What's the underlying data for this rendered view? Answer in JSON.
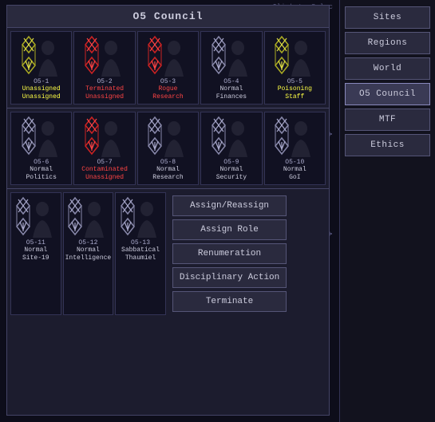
{
  "panel": {
    "title": "O5 Council"
  },
  "nav": {
    "buttons": [
      {
        "label": "Sites",
        "active": false
      },
      {
        "label": "Regions",
        "active": false
      },
      {
        "label": "World",
        "active": false
      },
      {
        "label": "O5 Council",
        "active": true
      },
      {
        "label": "MTF",
        "active": false
      },
      {
        "label": "Ethics",
        "active": false
      }
    ]
  },
  "agents": [
    {
      "id": "O5-1",
      "status_line1": "Unassigned",
      "status_line2": "Unassigned",
      "status_class": "status-unassigned",
      "flag": "unassigned"
    },
    {
      "id": "O5-2",
      "status_line1": "Terminated",
      "status_line2": "Unassigned",
      "status_class": "status-terminated",
      "flag": "terminated"
    },
    {
      "id": "O5-3",
      "status_line1": "Rogue",
      "status_line2": "Research",
      "status_class": "status-rogue",
      "flag": "rogue"
    },
    {
      "id": "O5-4",
      "status_line1": "Normal",
      "status_line2": "Finances",
      "status_class": "status-normal",
      "flag": "normal"
    },
    {
      "id": "O5-5",
      "status_line1": "Poisoning",
      "status_line2": "Staff",
      "status_class": "status-poisoning",
      "flag": "poisoning"
    },
    {
      "id": "O5-6",
      "status_line1": "Normal",
      "status_line2": "Politics",
      "status_class": "status-normal",
      "flag": "normal"
    },
    {
      "id": "O5-7",
      "status_line1": "Contaminated",
      "status_line2": "Unassigned",
      "status_class": "status-contaminated",
      "flag": "contaminated"
    },
    {
      "id": "O5-8",
      "status_line1": "Normal",
      "status_line2": "Research",
      "status_class": "status-normal",
      "flag": "normal"
    },
    {
      "id": "O5-9",
      "status_line1": "Normal",
      "status_line2": "Security",
      "status_class": "status-normal",
      "flag": "normal"
    },
    {
      "id": "O5-10",
      "status_line1": "Normal",
      "status_line2": "GoI",
      "status_class": "status-normal",
      "flag": "normal"
    },
    {
      "id": "O5-11",
      "status_line1": "Normal",
      "status_line2": "Site-19",
      "status_class": "status-normal",
      "flag": "normal"
    },
    {
      "id": "O5-12",
      "status_line1": "Normal",
      "status_line2": "Intelligence",
      "status_class": "status-normal",
      "flag": "normal"
    },
    {
      "id": "O5-13",
      "status_line1": "Sabbatical",
      "status_line2": "Thaumiel",
      "status_class": "status-normal",
      "flag": "normal"
    }
  ],
  "actions": {
    "assign_reassign": "Assign/Reassign",
    "assign_role": "Assign Role",
    "renumeration": "Renumeration",
    "disciplinary": "Disciplinary Action",
    "terminate": "Terminate"
  }
}
